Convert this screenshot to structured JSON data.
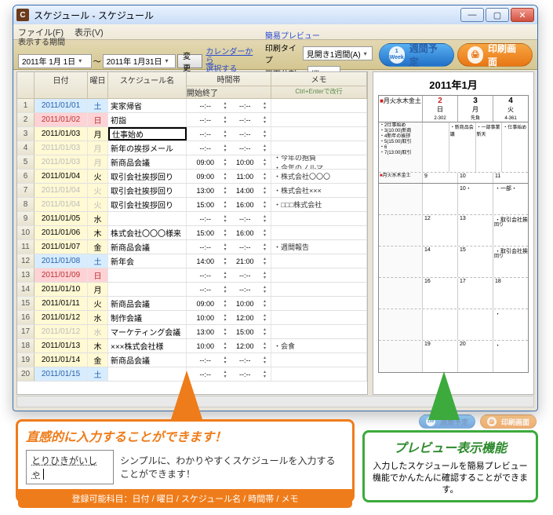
{
  "window": {
    "title": "スケジュール - スケジュール",
    "icon_glyph": "C",
    "min": "—",
    "max": "▢",
    "close": "✕"
  },
  "menu": {
    "file": "ファイル(F)",
    "view": "表示(V)"
  },
  "toolbar": {
    "period_label": "表示する期間",
    "date_from": "2011年 1月 1日",
    "tilde": "〜",
    "date_to": "2011年 1月31日",
    "change": "変更",
    "calendar_link_l1": "カレンダーから",
    "calendar_link_l2": "選択する",
    "preview_section_label": "簡易プレビュー",
    "print_type_label": "印刷タイプ",
    "print_type_value": "見開き1週間(A)",
    "page_split_label": "画面分割",
    "page_split_value": "縦",
    "week_btn_small": "1\nWeek",
    "week_btn_label": "週間予定",
    "print_btn_label": "印刷画面"
  },
  "grid": {
    "head": {
      "date": "日付",
      "dow": "曜日",
      "name": "スケジュール名",
      "time": "時間帯",
      "start": "開始",
      "end": "終了",
      "memo": "メモ",
      "memo_hint": "Ctrl+Enterで改行"
    },
    "rows": [
      {
        "i": "1",
        "date": "2011/01/01",
        "dow": "土",
        "cls": "date-sat",
        "name": "実家帰省",
        "t1": "--:--",
        "t2": "--:--",
        "memo": ""
      },
      {
        "i": "2",
        "date": "2011/01/02",
        "dow": "日",
        "cls": "date-sun",
        "name": "初詣",
        "t1": "--:--",
        "t2": "--:--",
        "memo": ""
      },
      {
        "i": "3",
        "date": "2011/01/03",
        "dow": "月",
        "cls": "date-wd",
        "name": "仕事始め",
        "edit": true,
        "t1": "--:--",
        "t2": "--:--",
        "memo": ""
      },
      {
        "i": "4",
        "date": "2011/01/03",
        "dow": "月",
        "cls": "date-wd date-gray",
        "name": "新年の挨拶メール",
        "t1": "--:--",
        "t2": "--:--",
        "memo": ""
      },
      {
        "i": "5",
        "date": "2011/01/03",
        "dow": "月",
        "cls": "date-wd date-gray",
        "name": "新商品会議",
        "t1": "09:00",
        "t2": "10:00",
        "memo": "・今年の抱負\n・今年のノルマ"
      },
      {
        "i": "6",
        "date": "2011/01/04",
        "dow": "火",
        "cls": "date-wd",
        "name": "取引会社挨拶回り",
        "t1": "09:00",
        "t2": "11:00",
        "memo": "・株式会社〇〇〇"
      },
      {
        "i": "7",
        "date": "2011/01/04",
        "dow": "火",
        "cls": "date-wd date-gray",
        "name": "取引会社挨拶回り",
        "t1": "13:00",
        "t2": "14:00",
        "memo": "・株式会社×××"
      },
      {
        "i": "8",
        "date": "2011/01/04",
        "dow": "火",
        "cls": "date-wd date-gray",
        "name": "取引会社挨拶回り",
        "t1": "15:00",
        "t2": "16:00",
        "memo": "・□□□株式会社"
      },
      {
        "i": "9",
        "date": "2011/01/05",
        "dow": "水",
        "cls": "date-wd",
        "name": "",
        "t1": "--:--",
        "t2": "--:--",
        "memo": ""
      },
      {
        "i": "10",
        "date": "2011/01/06",
        "dow": "木",
        "cls": "date-wd",
        "name": "株式会社〇〇〇様来",
        "t1": "15:00",
        "t2": "16:00",
        "memo": ""
      },
      {
        "i": "11",
        "date": "2011/01/07",
        "dow": "金",
        "cls": "date-wd",
        "name": "新商品会議",
        "t1": "--:--",
        "t2": "--:--",
        "memo": "・週間報告"
      },
      {
        "i": "12",
        "date": "2011/01/08",
        "dow": "土",
        "cls": "date-sat",
        "name": "新年会",
        "t1": "14:00",
        "t2": "21:00",
        "memo": ""
      },
      {
        "i": "13",
        "date": "2011/01/09",
        "dow": "日",
        "cls": "date-sun",
        "name": "",
        "t1": "--:--",
        "t2": "--:--",
        "memo": ""
      },
      {
        "i": "14",
        "date": "2011/01/10",
        "dow": "月",
        "cls": "date-wd",
        "name": "",
        "t1": "--:--",
        "t2": "--:--",
        "memo": ""
      },
      {
        "i": "15",
        "date": "2011/01/11",
        "dow": "火",
        "cls": "date-wd",
        "name": "新商品会議",
        "t1": "09:00",
        "t2": "10:00",
        "memo": ""
      },
      {
        "i": "16",
        "date": "2011/01/12",
        "dow": "水",
        "cls": "date-wd",
        "name": "制作会議",
        "t1": "10:00",
        "t2": "12:00",
        "memo": ""
      },
      {
        "i": "17",
        "date": "2011/01/12",
        "dow": "水",
        "cls": "date-wd date-gray",
        "name": "マーケティング会議",
        "t1": "13:00",
        "t2": "15:00",
        "memo": ""
      },
      {
        "i": "18",
        "date": "2011/01/13",
        "dow": "木",
        "cls": "date-wd",
        "name": "×××株式会社様",
        "t1": "10:00",
        "t2": "12:00",
        "memo": "・会食"
      },
      {
        "i": "19",
        "date": "2011/01/14",
        "dow": "金",
        "cls": "date-wd",
        "name": "新商品会議",
        "t1": "--:--",
        "t2": "--:--",
        "memo": ""
      },
      {
        "i": "20",
        "date": "2011/01/15",
        "dow": "土",
        "cls": "date-sat",
        "name": "",
        "t1": "--:--",
        "t2": "--:--",
        "memo": ""
      }
    ]
  },
  "preview": {
    "title": "2011年1月",
    "head_first": "月火水木金土",
    "cols": [
      {
        "num": "2",
        "lbl": "日",
        "sub": "2-302"
      },
      {
        "num": "3",
        "lbl": "月",
        "sub": "先負"
      },
      {
        "num": "4",
        "lbl": "火",
        "sub": "4-361"
      }
    ],
    "left_first": "・2仕事始め\n・3(10:00)新商\n・4新年の挨拶\n・5(15:00)取引\n・6\n・7(13:00)取引",
    "week2_label": "月火水木金土",
    "weeks": [
      {
        "left": "",
        "cells": [
          "",
          "・新商品会議",
          "・一部事業新天",
          "・仕事始め"
        ]
      },
      {
        "left": "",
        "cells": [
          "9",
          "10",
          "11"
        ]
      },
      {
        "left": "",
        "cells": [
          "",
          "10・",
          "・一部・"
        ]
      },
      {
        "left": "",
        "cells": [
          "12",
          "13",
          "・取引会社挨\n回り"
        ]
      },
      {
        "left": "",
        "cells": [
          "14",
          "15",
          "・取引会社挨\n回り"
        ]
      },
      {
        "left": "",
        "cells": [
          "16",
          "17",
          "18"
        ]
      },
      {
        "left": "",
        "cells": [
          "",
          "",
          "・"
        ]
      },
      {
        "left": "",
        "cells": [
          "19",
          "20",
          "・"
        ]
      }
    ]
  },
  "callout_orange": {
    "head": "直感的に入力することができます！",
    "ime_text": "とりひきがいしゃ",
    "body": "シンプルに、わかりやすくスケジュールを入力することができます！",
    "foot": "登録可能科目：日付 / 曜日 / スケジュール名 / 時間帯 / メモ"
  },
  "callout_green": {
    "head": "プレビュー表示機能",
    "body": "入力したスケジュールを簡易プレビュー機能でかんたんに確認することができます。"
  },
  "ghost": {
    "week": "週間予定",
    "print": "印刷画面"
  }
}
